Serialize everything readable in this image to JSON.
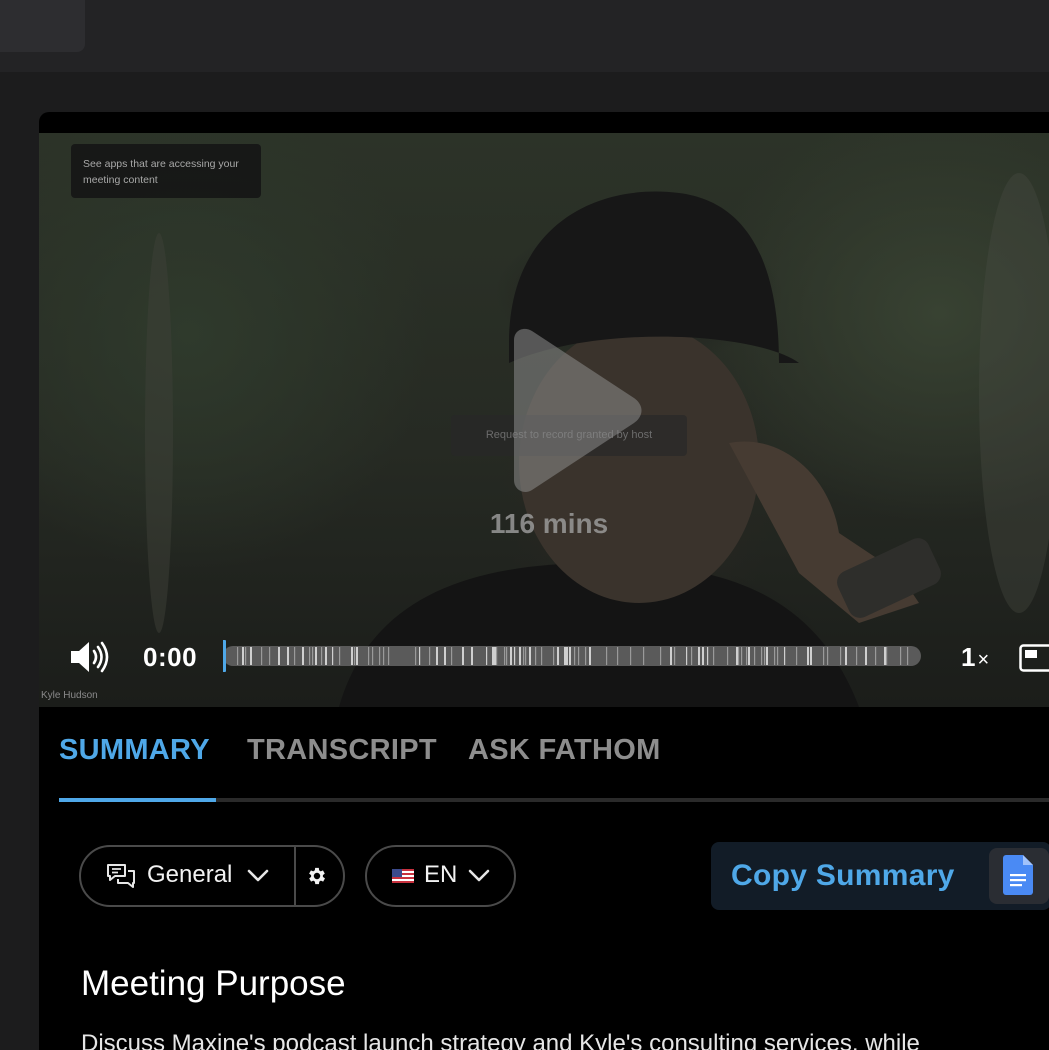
{
  "video": {
    "apps_notice": "See apps that are accessing your meeting content",
    "record_notice": "Request to record granted by host",
    "duration": "116 mins",
    "speaker_name": "Kyle Hudson",
    "current_time": "0:00",
    "playback_speed": "1",
    "speed_suffix": "×",
    "progress": 0.0
  },
  "tabs": [
    {
      "label": "SUMMARY",
      "active": true
    },
    {
      "label": "TRANSCRIPT",
      "active": false
    },
    {
      "label": "ASK FATHOM",
      "active": false
    }
  ],
  "summary_controls": {
    "mode_label": "General",
    "language_label": "EN",
    "copy_label": "Copy Summary"
  },
  "summary": {
    "section_title": "Meeting Purpose",
    "section_body": "Discuss Maxine's podcast launch strategy and Kyle's consulting services, while"
  },
  "colors": {
    "accent": "#4fa8e8",
    "panel": "#000000",
    "background": "#1c1c1d"
  },
  "icons": [
    "volume-icon",
    "play-icon",
    "pip-icon",
    "chat-bubbles-icon",
    "chevron-down-icon",
    "gear-icon",
    "us-flag-icon",
    "google-docs-icon"
  ]
}
